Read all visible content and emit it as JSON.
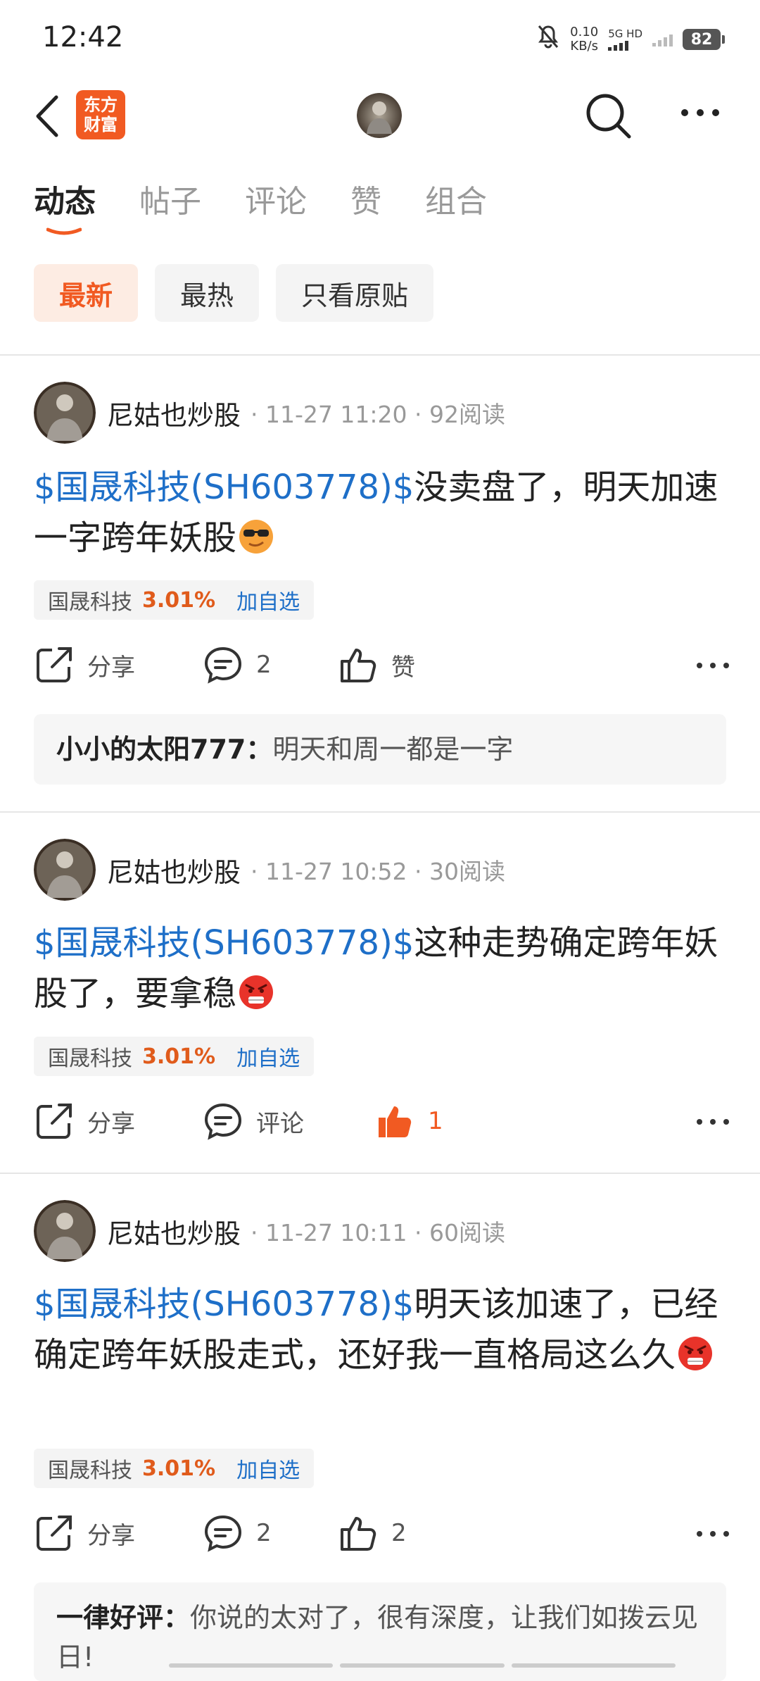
{
  "status": {
    "time": "12:42",
    "net_speed": "0.10",
    "net_unit": "KB/s",
    "signal_label": "5G HD",
    "battery": "82"
  },
  "topbar": {
    "logo_text": "东方财富"
  },
  "tabs": [
    {
      "label": "动态",
      "active": true
    },
    {
      "label": "帖子"
    },
    {
      "label": "评论"
    },
    {
      "label": "赞"
    },
    {
      "label": "组合"
    }
  ],
  "filters": [
    {
      "label": "最新",
      "active": true
    },
    {
      "label": "最热"
    },
    {
      "label": "只看原贴"
    }
  ],
  "posts": [
    {
      "author": "尼姑也炒股",
      "time": "11-27 11:20",
      "reads": "92阅读",
      "ticker": "$国晟科技(SH603778)$",
      "text": "没卖盘了，明天加速一字跨年妖股",
      "emoji": "cool",
      "stock_name": "国晟科技",
      "stock_pct": "3.01%",
      "add_label": "加自选",
      "share_label": "分享",
      "comment_count": "2",
      "like_label": "赞",
      "comment": {
        "name": "小小的太阳777：",
        "text": "明天和周一都是一字"
      }
    },
    {
      "author": "尼姑也炒股",
      "time": "11-27 10:52",
      "reads": "30阅读",
      "ticker": "$国晟科技(SH603778)$",
      "text": "这种走势确定跨年妖股了，要拿稳",
      "emoji": "angry",
      "stock_name": "国晟科技",
      "stock_pct": "3.01%",
      "add_label": "加自选",
      "share_label": "分享",
      "comment_label": "评论",
      "like_count": "1"
    },
    {
      "author": "尼姑也炒股",
      "time": "11-27 10:11",
      "reads": "60阅读",
      "ticker": "$国晟科技(SH603778)$",
      "text": "明天该加速了，已经确定跨年妖股走式，还好我一直格局这么久",
      "emoji": "angry",
      "stock_name": "国晟科技",
      "stock_pct": "3.01%",
      "add_label": "加自选",
      "share_label": "分享",
      "comment_count": "2",
      "like_count": "2",
      "comment": {
        "name": "一律好评：",
        "text": "你说的太对了，很有深度，让我们如拨云见日!"
      }
    }
  ],
  "colors": {
    "accent": "#f15a22",
    "link": "#1e6fc8",
    "pct": "#e05b1b"
  }
}
